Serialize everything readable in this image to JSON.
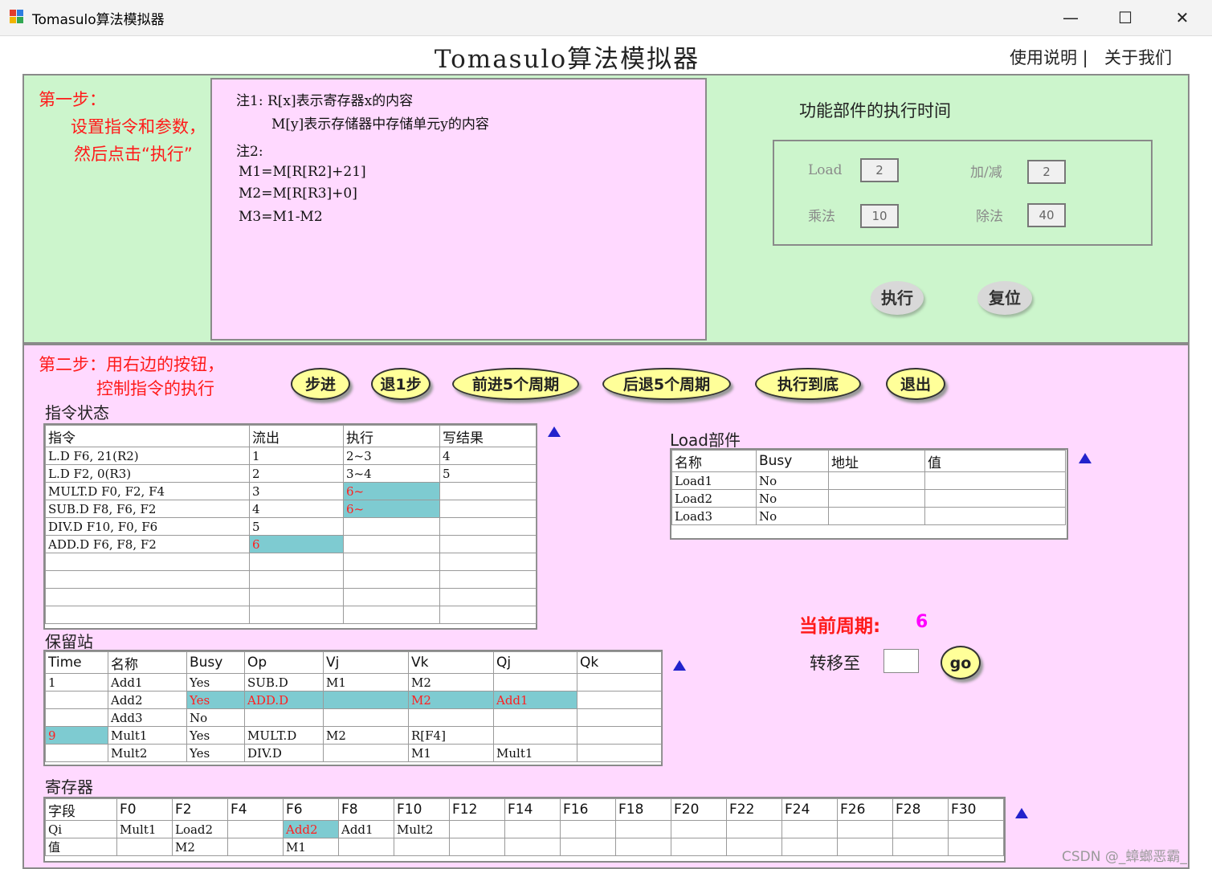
{
  "window": {
    "title": "Tomasulo算法模拟器",
    "min": "—",
    "max": "☐",
    "close": "✕"
  },
  "header": {
    "title": "Tomasulo算法模拟器",
    "help": "使用说明 |",
    "about": "关于我们"
  },
  "step1": {
    "line1": "第一步：",
    "line2": "设置指令和参数，",
    "line3": "然后点击“执行”"
  },
  "notes": {
    "n1a": "注1:  R[x]表示寄存器x的内容",
    "n1b": "M[y]表示存储器中存储单元y的内容",
    "n2": "注2:",
    "m1": "M1=M[R[R2]+21]",
    "m2": "M2=M[R[R3]+0]",
    "m3": "M3=M1-M2"
  },
  "fu": {
    "title": "功能部件的执行时间",
    "load_label": "Load",
    "load_value": "2",
    "add_label": "加/减",
    "add_value": "2",
    "mul_label": "乘法",
    "mul_value": "10",
    "div_label": "除法",
    "div_value": "40",
    "execute_button": "执行",
    "reset_button": "复位"
  },
  "step2": {
    "line1": "第二步：用右边的按钮，",
    "line2": "控制指令的执行"
  },
  "controls": {
    "step": "步进",
    "back1": "退1步",
    "fwd5": "前进5个周期",
    "back5": "后退5个周期",
    "run_end": "执行到底",
    "exit": "退出"
  },
  "instr_status": {
    "title": "指令状态",
    "headers": [
      "指令",
      "流出",
      "执行",
      "写结果"
    ],
    "rows": [
      [
        {
          "v": "L.D    F6, 21(R2)"
        },
        {
          "v": "1"
        },
        {
          "v": "2~3"
        },
        {
          "v": "4"
        }
      ],
      [
        {
          "v": "L.D    F2, 0(R3)"
        },
        {
          "v": "2"
        },
        {
          "v": "3~4"
        },
        {
          "v": "5"
        }
      ],
      [
        {
          "v": "MULT.D F0, F2, F4"
        },
        {
          "v": "3"
        },
        {
          "v": "6~",
          "hl": true
        },
        {
          "v": ""
        }
      ],
      [
        {
          "v": "SUB.D  F8, F6, F2"
        },
        {
          "v": "4"
        },
        {
          "v": "6~",
          "hl": true
        },
        {
          "v": ""
        }
      ],
      [
        {
          "v": "DIV.D  F10, F0, F6"
        },
        {
          "v": "5"
        },
        {
          "v": ""
        },
        {
          "v": ""
        }
      ],
      [
        {
          "v": "ADD.D  F6, F8, F2"
        },
        {
          "v": "6",
          "hl": true
        },
        {
          "v": ""
        },
        {
          "v": ""
        }
      ],
      [
        {
          "v": ""
        },
        {
          "v": ""
        },
        {
          "v": ""
        },
        {
          "v": ""
        }
      ],
      [
        {
          "v": ""
        },
        {
          "v": ""
        },
        {
          "v": ""
        },
        {
          "v": ""
        }
      ],
      [
        {
          "v": ""
        },
        {
          "v": ""
        },
        {
          "v": ""
        },
        {
          "v": ""
        }
      ],
      [
        {
          "v": ""
        },
        {
          "v": ""
        },
        {
          "v": ""
        },
        {
          "v": ""
        }
      ]
    ]
  },
  "load_unit": {
    "title": "Load部件",
    "headers": [
      "名称",
      "Busy",
      "地址",
      "值"
    ],
    "rows": [
      [
        {
          "v": "Load1"
        },
        {
          "v": "No"
        },
        {
          "v": ""
        },
        {
          "v": ""
        }
      ],
      [
        {
          "v": "Load2"
        },
        {
          "v": "No"
        },
        {
          "v": ""
        },
        {
          "v": ""
        }
      ],
      [
        {
          "v": "Load3"
        },
        {
          "v": "No"
        },
        {
          "v": ""
        },
        {
          "v": ""
        }
      ]
    ]
  },
  "reservation": {
    "title": "保留站",
    "headers": [
      "Time",
      "名称",
      "Busy",
      "Op",
      "Vj",
      "Vk",
      "Qj",
      "Qk"
    ],
    "rows": [
      [
        {
          "v": "1"
        },
        {
          "v": "Add1"
        },
        {
          "v": "Yes"
        },
        {
          "v": "SUB.D"
        },
        {
          "v": "M1"
        },
        {
          "v": "M2"
        },
        {
          "v": ""
        },
        {
          "v": ""
        }
      ],
      [
        {
          "v": ""
        },
        {
          "v": "Add2"
        },
        {
          "v": "Yes",
          "hl": true
        },
        {
          "v": "ADD.D",
          "hl": true
        },
        {
          "v": "",
          "hl": true
        },
        {
          "v": "M2",
          "hl": true
        },
        {
          "v": "Add1",
          "hl": true
        },
        {
          "v": ""
        }
      ],
      [
        {
          "v": ""
        },
        {
          "v": "Add3"
        },
        {
          "v": "No"
        },
        {
          "v": ""
        },
        {
          "v": ""
        },
        {
          "v": ""
        },
        {
          "v": ""
        },
        {
          "v": ""
        }
      ],
      [
        {
          "v": "9",
          "hl": true
        },
        {
          "v": "Mult1"
        },
        {
          "v": "Yes"
        },
        {
          "v": "MULT.D"
        },
        {
          "v": "M2"
        },
        {
          "v": "R[F4]"
        },
        {
          "v": ""
        },
        {
          "v": ""
        }
      ],
      [
        {
          "v": ""
        },
        {
          "v": "Mult2"
        },
        {
          "v": "Yes"
        },
        {
          "v": "DIV.D"
        },
        {
          "v": ""
        },
        {
          "v": "M1"
        },
        {
          "v": "Mult1"
        },
        {
          "v": ""
        }
      ]
    ]
  },
  "registers": {
    "title": "寄存器",
    "headers": [
      "字段",
      "F0",
      "F2",
      "F4",
      "F6",
      "F8",
      "F10",
      "F12",
      "F14",
      "F16",
      "F18",
      "F20",
      "F22",
      "F24",
      "F26",
      "F28",
      "F30"
    ],
    "rows": [
      [
        {
          "v": "Qi"
        },
        {
          "v": "Mult1"
        },
        {
          "v": "Load2"
        },
        {
          "v": ""
        },
        {
          "v": "Add2",
          "hl": true
        },
        {
          "v": "Add1"
        },
        {
          "v": "Mult2"
        },
        {
          "v": ""
        },
        {
          "v": ""
        },
        {
          "v": ""
        },
        {
          "v": ""
        },
        {
          "v": ""
        },
        {
          "v": ""
        },
        {
          "v": ""
        },
        {
          "v": ""
        },
        {
          "v": ""
        },
        {
          "v": ""
        }
      ],
      [
        {
          "v": "值"
        },
        {
          "v": ""
        },
        {
          "v": "M2"
        },
        {
          "v": ""
        },
        {
          "v": "M1"
        },
        {
          "v": ""
        },
        {
          "v": ""
        },
        {
          "v": ""
        },
        {
          "v": ""
        },
        {
          "v": ""
        },
        {
          "v": ""
        },
        {
          "v": ""
        },
        {
          "v": ""
        },
        {
          "v": ""
        },
        {
          "v": ""
        },
        {
          "v": ""
        },
        {
          "v": ""
        }
      ]
    ]
  },
  "cycle": {
    "label": "当前周期:",
    "value": "6",
    "goto_label": "转移至",
    "goto_value": "",
    "go_button": "go"
  },
  "watermark": "CSDN @_蟑螂恶霸_",
  "colors": {
    "green_panel": "#ccf5cc",
    "pink_panel": "#ffd9ff",
    "highlight": "#7ecbd1",
    "alert_red": "#ff1a1a",
    "cycle_magenta": "#ff00ff",
    "button_yellow": "#ffff99"
  }
}
